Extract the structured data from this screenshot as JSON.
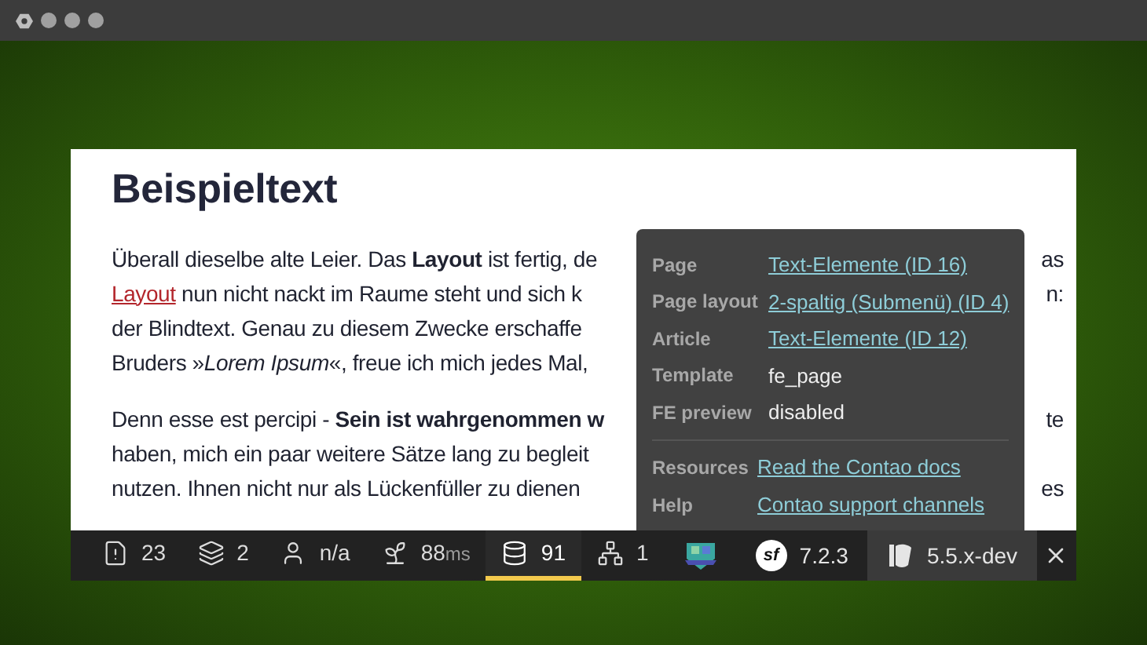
{
  "article": {
    "heading": "Beispieltext",
    "paragraphs": [
      [
        {
          "left": "Überall dieselbe alte Leier. Das **Layout** ist fertig, de",
          "right": "as"
        },
        {
          "link": "Layout",
          "left": " nun nicht nackt im Raume steht und sich k",
          "right": "n:"
        },
        {
          "left": "der Blindtext. Genau zu diesem Zwecke erschaffe"
        },
        {
          "left": "Bruders »*Lorem Ipsum*«, freue ich mich jedes Mal,"
        }
      ],
      [
        {
          "left": "Denn esse est percipi - **Sein ist wahrgenommen w**",
          "right": "te"
        },
        {
          "left": "haben, mich ein paar weitere Sätze lang zu begleit"
        },
        {
          "left": "nutzen. Ihnen nicht nur als Lückenfüller zu dienen",
          "right": "es"
        }
      ]
    ]
  },
  "popup": {
    "rows": [
      {
        "label": "Page",
        "value": "Text-Elemente (ID 16)",
        "kind": "link"
      },
      {
        "label": "Page layout",
        "value": "2-spaltig (Submenü) (ID 4)",
        "kind": "link"
      },
      {
        "label": "Article",
        "value": "Text-Elemente (ID 12)",
        "kind": "link"
      },
      {
        "label": "Template",
        "value": "fe_page",
        "kind": "text"
      },
      {
        "label": "FE preview",
        "value": "disabled",
        "kind": "text"
      }
    ],
    "links": [
      {
        "label": "Resources",
        "value": "Read the Contao docs"
      },
      {
        "label": "Help",
        "value": "Contao support channels"
      }
    ]
  },
  "toolbar": {
    "items": [
      {
        "kind": "alert",
        "value": "23",
        "selected": false
      },
      {
        "kind": "layers",
        "value": "2",
        "selected": false
      },
      {
        "kind": "user",
        "value": "n/a",
        "selected": false
      },
      {
        "kind": "sprout",
        "value": "88",
        "unit": "ms",
        "selected": false
      },
      {
        "kind": "database",
        "value": "91",
        "selected": true
      },
      {
        "kind": "tree",
        "value": "1",
        "selected": false
      },
      {
        "kind": "logo"
      }
    ],
    "symfony": {
      "logo": "sf",
      "version": "7.2.3"
    },
    "contao": {
      "version": "5.5.x-dev"
    }
  }
}
